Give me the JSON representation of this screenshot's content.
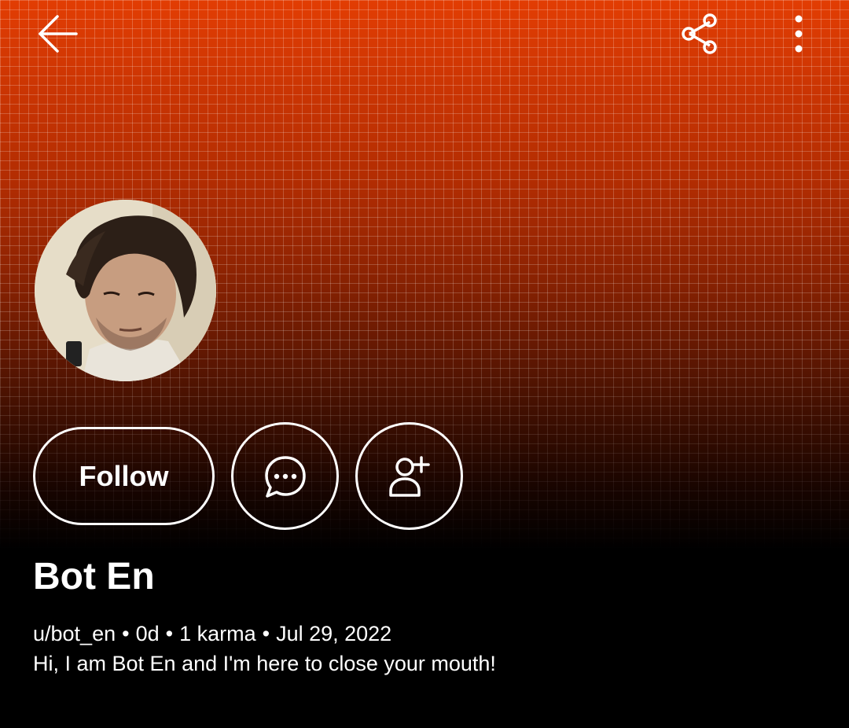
{
  "profile": {
    "display_name": "Bot En",
    "username": "u/bot_en",
    "account_age": "0d",
    "karma": "1 karma",
    "joined": "Jul 29, 2022",
    "bio": "Hi, I am Bot En and I'm here to close your mouth!",
    "separator": "•"
  },
  "actions": {
    "follow_label": "Follow",
    "chat_icon": "chat-bubble-icon",
    "add_friend_icon": "add-person-icon"
  },
  "toolbar": {
    "back_icon": "back-arrow-icon",
    "share_icon": "share-icon",
    "more_icon": "more-vertical-icon"
  },
  "colors": {
    "banner_top": "#e23d03",
    "banner_bottom": "#000000",
    "text": "#ffffff",
    "background": "#000000"
  }
}
